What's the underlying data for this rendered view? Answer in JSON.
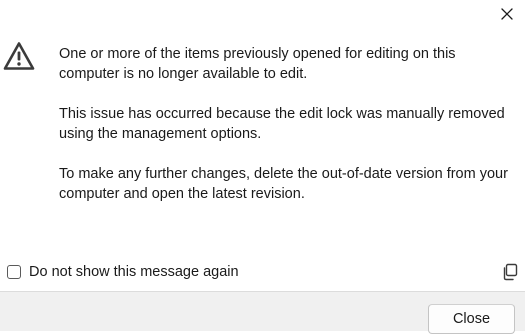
{
  "titlebar": {
    "close_icon": "close-icon"
  },
  "message": {
    "icon": "warning-triangle-icon",
    "paragraphs": [
      "One or more of the items previously opened for editing on this computer is no longer available to edit.",
      "This issue has occurred because the edit lock was manually removed using the management options.",
      "To make any further changes, delete the out-of-date version from your computer and open the latest revision."
    ]
  },
  "options": {
    "dont_show_label": "Do not show this message again",
    "dont_show_checked": false,
    "copy_icon": "copy-icon"
  },
  "buttons": {
    "close_label": "Close"
  },
  "colors": {
    "text": "#1a1a1a",
    "button_bar_bg": "#f0f0f0",
    "icon_dark": "#3b3b3b"
  }
}
